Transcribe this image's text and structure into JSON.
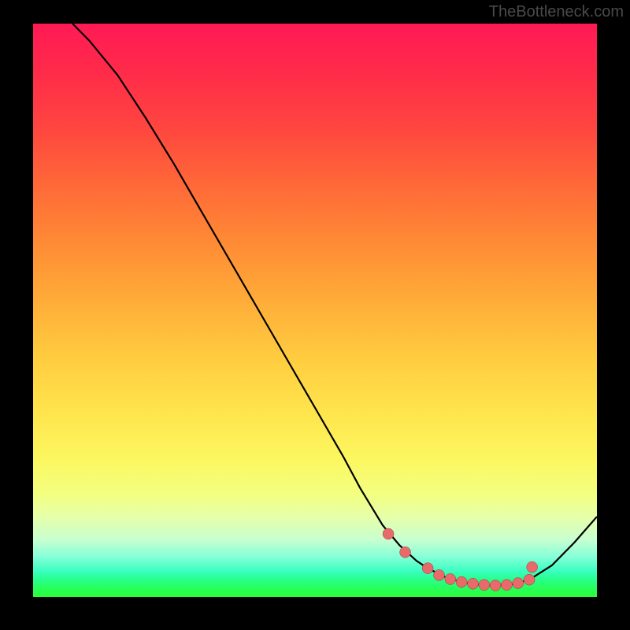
{
  "watermark": "TheBottleneck.com",
  "chart_data": {
    "type": "line",
    "title": "",
    "xlabel": "",
    "ylabel": "",
    "xlim": [
      0,
      100
    ],
    "ylim": [
      0,
      100
    ],
    "series": [
      {
        "name": "curve",
        "x": [
          7,
          10,
          15,
          20,
          25,
          30,
          35,
          40,
          45,
          50,
          55,
          58,
          62,
          65,
          68,
          70,
          73,
          76,
          79,
          82,
          85,
          88,
          92,
          96,
          100
        ],
        "y": [
          100,
          97,
          91,
          83.5,
          75.5,
          67,
          58.5,
          50,
          41.5,
          33,
          24.5,
          19,
          12.5,
          9,
          6.3,
          5,
          3.5,
          2.6,
          2.1,
          2,
          2.2,
          3,
          5.5,
          9.5,
          14
        ]
      }
    ],
    "markers": {
      "name": "highlight-points",
      "x": [
        63,
        66,
        70,
        72,
        74,
        76,
        78,
        80,
        82,
        84,
        86,
        88,
        88.5
      ],
      "y": [
        11,
        7.8,
        5,
        3.8,
        3.1,
        2.6,
        2.3,
        2.1,
        2,
        2.1,
        2.4,
        3,
        5.2
      ]
    },
    "background_gradient": {
      "orientation": "vertical",
      "stops": [
        {
          "pos": 0.0,
          "color": "#ff1a55"
        },
        {
          "pos": 0.5,
          "color": "#ffcb3f"
        },
        {
          "pos": 0.82,
          "color": "#f3ff80"
        },
        {
          "pos": 0.95,
          "color": "#3affc0"
        },
        {
          "pos": 1.0,
          "color": "#28ff38"
        }
      ]
    }
  }
}
